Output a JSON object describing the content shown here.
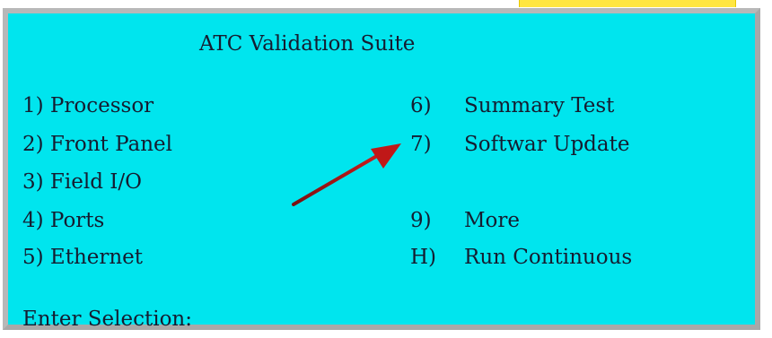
{
  "terminal": {
    "title": "ATC Validation Suite",
    "left_menu": [
      "1) Processor",
      "2) Front Panel",
      "3) Field I/O",
      "4) Ports",
      "5) Ethernet"
    ],
    "right_menu": [
      {
        "key": "6)",
        "label": "Summary Test"
      },
      {
        "key": "7)",
        "label": "Softwar Update"
      },
      {
        "key": "9)",
        "label": "More"
      },
      {
        "key": "H)",
        "label": "Run Continuous"
      }
    ],
    "prompt": "Enter Selection:",
    "background_color": "#00e5ee",
    "text_color": "#151c30"
  },
  "annotation": {
    "arrow_color": "#b01818",
    "highlight_color": "#ffe640"
  }
}
